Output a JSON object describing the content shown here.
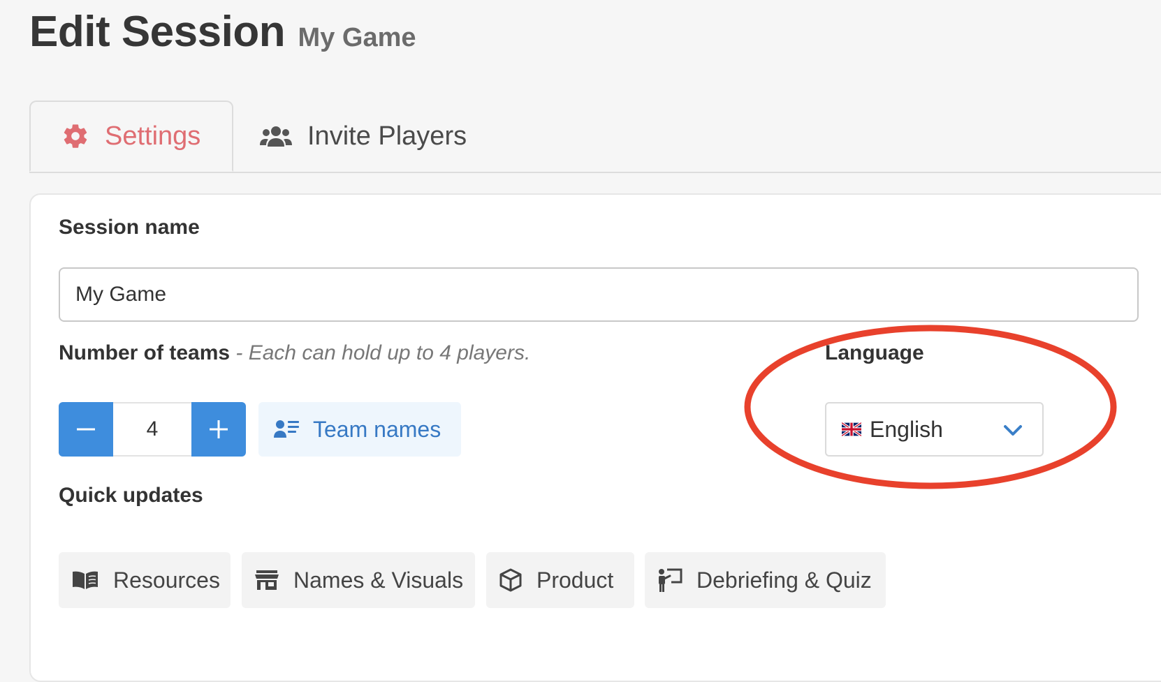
{
  "header": {
    "title": "Edit Session",
    "subtitle": "My Game"
  },
  "tabs": [
    {
      "label": "Settings",
      "icon": "gear-icon",
      "active": true
    },
    {
      "label": "Invite Players",
      "icon": "users-icon",
      "active": false
    }
  ],
  "form": {
    "session_name_label": "Session name",
    "session_name_value": "My Game",
    "teams_label": "Number of teams",
    "teams_hint": " - Each can hold up to 4 players.",
    "teams_value": "4",
    "team_names_label": "Team names",
    "language_label": "Language",
    "language_value": "English",
    "language_flag": "uk-flag-icon",
    "quick_updates_label": "Quick updates",
    "quick_updates": [
      {
        "label": "Resources",
        "icon": "book-open-icon"
      },
      {
        "label": "Names & Visuals",
        "icon": "store-icon"
      },
      {
        "label": "Product",
        "icon": "box-icon"
      },
      {
        "label": "Debriefing & Quiz",
        "icon": "presenter-icon"
      }
    ]
  },
  "colors": {
    "accent_tab": "#df6d72",
    "primary_button": "#3e8ddd",
    "annotation": "#e8412c",
    "page_background": "#f6f6f6"
  }
}
